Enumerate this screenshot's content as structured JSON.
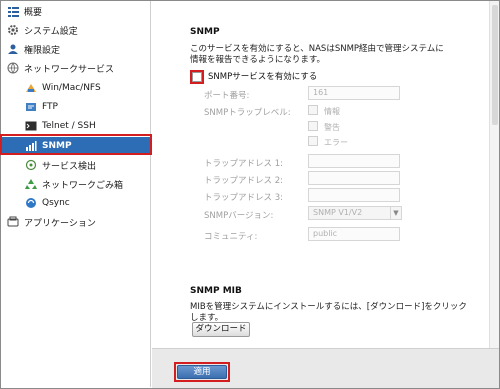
{
  "sidebar": {
    "items": [
      {
        "label": "概要",
        "icon": "list-icon"
      },
      {
        "label": "システム設定",
        "icon": "gear-icon"
      },
      {
        "label": "権限設定",
        "icon": "user-icon"
      },
      {
        "label": "ネットワークサービス",
        "icon": "network-icon"
      },
      {
        "label": "Win/Mac/NFS",
        "icon": "share-icon"
      },
      {
        "label": "FTP",
        "icon": "ftp-icon"
      },
      {
        "label": "Telnet / SSH",
        "icon": "terminal-icon"
      },
      {
        "label": "SNMP",
        "icon": "snmp-icon"
      },
      {
        "label": "サービス検出",
        "icon": "discovery-icon"
      },
      {
        "label": "ネットワークごみ箱",
        "icon": "recycle-icon"
      },
      {
        "label": "Qsync",
        "icon": "sync-icon"
      },
      {
        "label": "アプリケーション",
        "icon": "app-icon"
      }
    ]
  },
  "snmp": {
    "title": "SNMP",
    "description": "このサービスを有効にすると、NASはSNMP経由で管理システムに情報を報告できるようになります。",
    "enable_label": "SNMPサービスを有効にする",
    "port_label": "ポート番号:",
    "port_value": "161",
    "trap_level_label": "SNMPトラップレベル:",
    "trap_levels": [
      "情報",
      "警告",
      "エラー"
    ],
    "trap1_label": "トラップアドレス 1:",
    "trap2_label": "トラップアドレス 2:",
    "trap3_label": "トラップアドレス 3:",
    "version_label": "SNMPバージョン:",
    "version_value": "SNMP V1/V2",
    "community_label": "コミュニティ:",
    "community_value": "public"
  },
  "mib": {
    "title": "SNMP MIB",
    "description": "MIBを管理システムにインストールするには、[ダウンロード]をクリックします。",
    "download_label": "ダウンロード"
  },
  "footer": {
    "apply_label": "適用"
  },
  "colors": {
    "accent": "#2d6db5",
    "highlight": "#d21e1e"
  }
}
